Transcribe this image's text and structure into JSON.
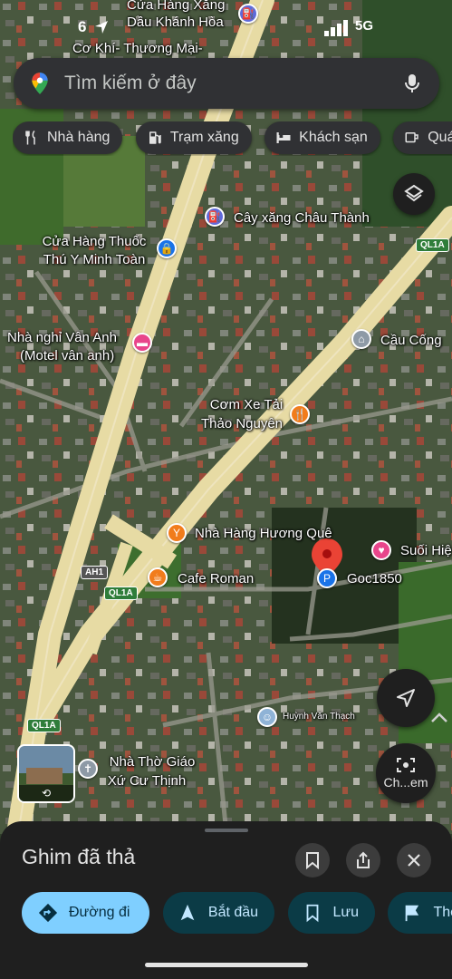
{
  "status_bar": {
    "time": "6",
    "network": "5G"
  },
  "search": {
    "placeholder": "Tìm kiếm ở đây"
  },
  "chips": [
    "Nhà hàng",
    "Trạm xăng",
    "Khách sạn",
    "Quán"
  ],
  "map": {
    "top_labels": [
      "Cửa Hàng Xăng",
      "Dầu Khánh Hòa",
      "Cơ Khí- Thương Mại-"
    ],
    "places": {
      "cay_xang": "Cây xăng Châu Thành",
      "cua_hang_thuoc_1": "Cửa Hàng Thuốc",
      "cua_hang_thuoc_2": "Thú Y Minh Toàn",
      "nha_nghi_1": "Nhà nghỉ Vân Anh",
      "nha_nghi_2": "(Motel vân anh)",
      "cau_cong": "Cầu Cống",
      "com_xe_tai_1": "Cơm Xe Tải",
      "com_xe_tai_2": "Thảo Nguyên",
      "nha_hang": "Nhà Hàng Hương Quê",
      "suoi": "Suối Hiệ",
      "cafe": "Cafe Roman",
      "goc": "Goc1850",
      "user": "Huỳnh Văn Thạch",
      "nha_tho_1": "Nhà Thờ Giáo",
      "nha_tho_2": "Xứ Cư Thịnh"
    },
    "shields": {
      "ql1a_top": "QL1A",
      "ah1": "AH1",
      "ql1a_mid": "QL1A",
      "ql1a_bot": "QL1A"
    },
    "streetview_label": "Ch...em"
  },
  "sheet": {
    "title": "Ghim đã thả",
    "actions": [
      "Đường đi",
      "Bắt đầu",
      "Lưu",
      "Thêm"
    ]
  }
}
